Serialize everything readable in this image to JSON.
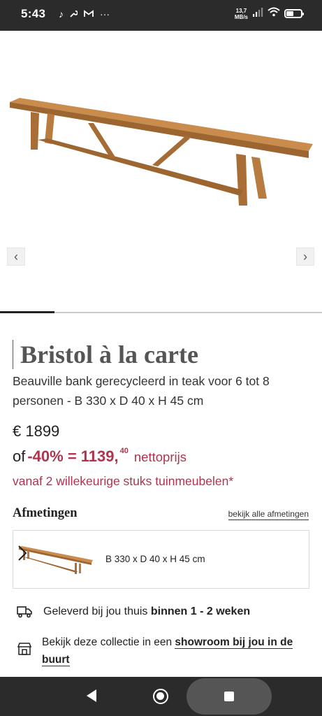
{
  "status_bar": {
    "time": "5:43",
    "left_icons": [
      "music-note-icon",
      "wrench-icon",
      "gmail-icon",
      "more-dots-icon"
    ],
    "net_speed_value": "13,7",
    "net_speed_unit": "MB/s",
    "battery_level": 0.45
  },
  "gallery": {
    "prev_label": "‹",
    "next_label": "›",
    "progress": 0.17
  },
  "product": {
    "brand": "Bristol à la carte",
    "subtitle": "Beauville bank gerecycleerd in teak voor 6 tot 8 personen - B 330 x D 40 x H 45 cm",
    "price": "€ 1899",
    "discount_prefix": "of",
    "discount_main": "-40% = 1139,",
    "discount_cents": "40",
    "discount_suffix": "nettoprijs",
    "promo": "vanaf 2 willekeurige stuks tuinmeubelen*"
  },
  "dimensions": {
    "title": "Afmetingen",
    "link": "bekijk alle afmetingen",
    "card_text": "B 330 x D 40 x H 45 cm"
  },
  "info": {
    "delivery_prefix": "Geleverd bij jou thuis ",
    "delivery_bold": "binnen 1 - 2 weken",
    "showroom_prefix": "Bekijk deze collectie in een ",
    "showroom_link": "showroom bij jou in de buurt"
  },
  "colors": {
    "accent": "#b0344e",
    "bars": "#2b2b2b",
    "wood": "#b97a3c"
  }
}
